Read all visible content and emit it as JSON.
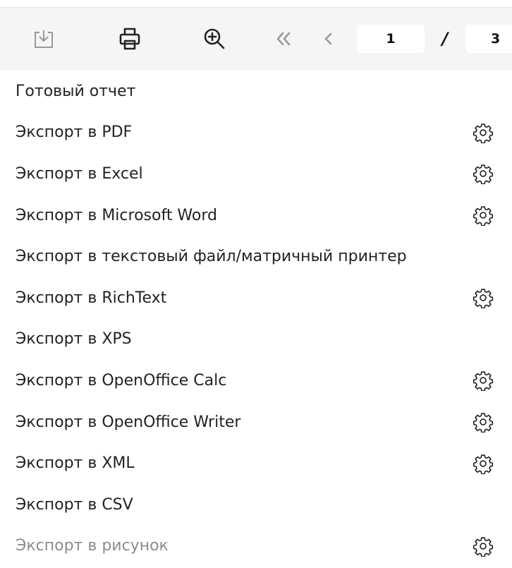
{
  "toolbar": {
    "icons": [
      "download-icon",
      "print-icon",
      "zoom-in-icon",
      "first-page-icon",
      "previous-page-icon"
    ],
    "current_page": "1",
    "page_separator": "/",
    "total_pages": "3"
  },
  "menu": {
    "items": [
      {
        "label": "Готовый отчет",
        "has_settings": false,
        "disabled": false
      },
      {
        "label": "Экспорт в PDF",
        "has_settings": true,
        "disabled": false
      },
      {
        "label": "Экспорт в Excel",
        "has_settings": true,
        "disabled": false
      },
      {
        "label": "Экспорт в Microsoft Word",
        "has_settings": true,
        "disabled": false
      },
      {
        "label": "Экспорт в текстовый файл/матричный принтер",
        "has_settings": false,
        "disabled": false
      },
      {
        "label": "Экспорт в RichText",
        "has_settings": true,
        "disabled": false
      },
      {
        "label": "Экспорт в XPS",
        "has_settings": false,
        "disabled": false
      },
      {
        "label": "Экспорт в OpenOffice Calc",
        "has_settings": true,
        "disabled": false
      },
      {
        "label": "Экспорт в OpenOffice Writer",
        "has_settings": true,
        "disabled": false
      },
      {
        "label": "Экспорт в XML",
        "has_settings": true,
        "disabled": false
      },
      {
        "label": "Экспорт в CSV",
        "has_settings": false,
        "disabled": false
      },
      {
        "label": "Экспорт в рисунок",
        "has_settings": true,
        "disabled": true
      }
    ],
    "settings_icon": "gear-icon"
  },
  "colors": {
    "toolbar_bg": "#f5f5f5",
    "icon_dim": "#9a9a9a",
    "icon_dark": "#222222",
    "disabled_text": "#8c8c8c"
  }
}
